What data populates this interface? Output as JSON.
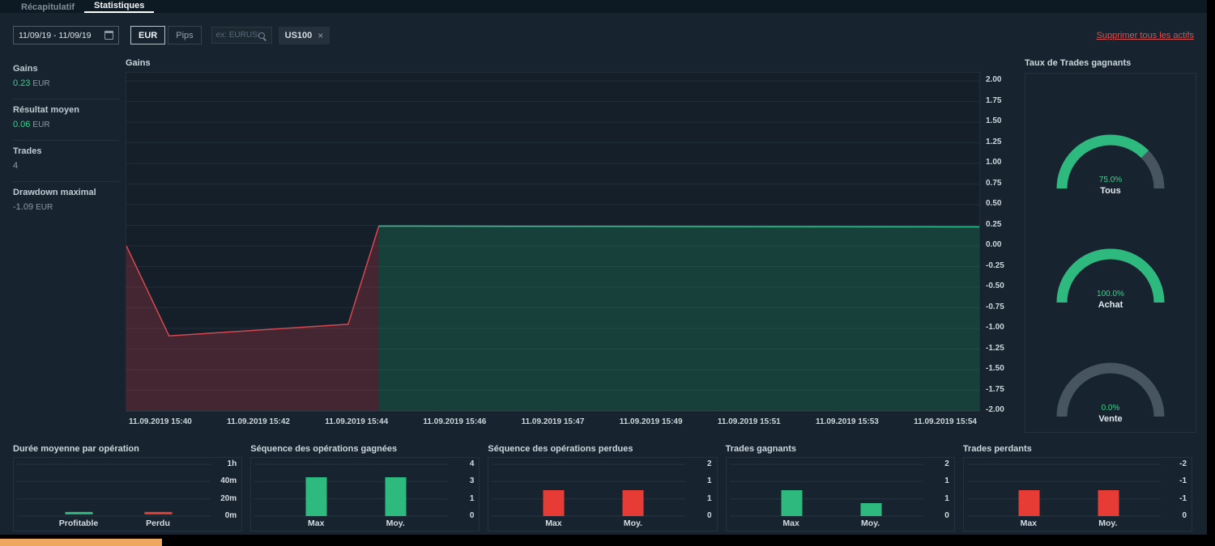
{
  "tabs": [
    {
      "label": "Récapitulatif",
      "active": false
    },
    {
      "label": "Statistiques",
      "active": true
    }
  ],
  "toolbar": {
    "date_range": "11/09/19 - 11/09/19",
    "unit_buttons": [
      {
        "label": "EUR",
        "active": true
      },
      {
        "label": "Pips",
        "active": false
      }
    ],
    "search_placeholder": "ex: EURUSD",
    "asset_tag": {
      "label": "US100",
      "remove": "×"
    },
    "remove_all_link": "Supprimer tous les actifs"
  },
  "summary_stats": [
    {
      "label": "Gains",
      "value": "0.23",
      "unit": "EUR",
      "tone": "green"
    },
    {
      "label": "Résultat moyen",
      "value": "0.06",
      "unit": "EUR",
      "tone": "green"
    },
    {
      "label": "Trades",
      "value": "4",
      "unit": "",
      "tone": "gray"
    },
    {
      "label": "Drawdown maximal",
      "value": "-1.09",
      "unit": "EUR",
      "tone": "gray"
    }
  ],
  "colors": {
    "green": "#2eb97e",
    "green_line": "#35c491",
    "green_fill": "rgba(34,150,104,0.28)",
    "green_text": "#3ecf8e",
    "red": "#e63c35",
    "red_line": "#d5484f",
    "red_fill": "rgba(178,55,65,0.30)",
    "grid": "#202e3a",
    "grid2": "#263442",
    "gauge_track": "#46555f",
    "link_red": "#d95151",
    "orange_strip": "#eda75e"
  },
  "chart_data": [
    {
      "id": "gains",
      "type": "area",
      "title": "Gains",
      "ylabel": "",
      "ylim": [
        -2,
        2
      ],
      "y_ticks": [
        "2.00",
        "1.75",
        "1.50",
        "1.25",
        "1.00",
        "0.75",
        "0.50",
        "0.25",
        "0.00",
        "-0.25",
        "-0.50",
        "-0.75",
        "-1.00",
        "-1.25",
        "-1.50",
        "-1.75",
        "-2.00"
      ],
      "x_ticks": [
        "11.09.2019 15:40",
        "11.09.2019 15:42",
        "11.09.2019 15:44",
        "11.09.2019 15:46",
        "11.09.2019 15:47",
        "11.09.2019 15:49",
        "11.09.2019 15:51",
        "11.09.2019 15:53",
        "11.09.2019 15:54"
      ],
      "series": [
        {
          "name": "losing-segment",
          "color_key": "red",
          "points": [
            [
              0.0,
              0.0
            ],
            [
              0.05,
              -1.09
            ],
            [
              0.26,
              -0.95
            ],
            [
              0.296,
              0.24
            ]
          ]
        },
        {
          "name": "winning-segment",
          "color_key": "green",
          "points": [
            [
              0.296,
              0.24
            ],
            [
              1.0,
              0.23
            ]
          ]
        }
      ]
    },
    {
      "id": "win_rate",
      "type": "gauge",
      "title": "Taux de Trades gagnants",
      "gauges": [
        {
          "label": "Tous",
          "value_pct": 75.0,
          "display": "75.0%"
        },
        {
          "label": "Achat",
          "value_pct": 100.0,
          "display": "100.0%"
        },
        {
          "label": "Vente",
          "value_pct": 0.0,
          "display": "0.0%"
        }
      ]
    },
    {
      "id": "avg_duration",
      "type": "duration",
      "title": "Durée moyenne par opération",
      "y_ticks": [
        "1h",
        "40m",
        "20m",
        "0m"
      ],
      "ymax_minutes": 60,
      "categories": [
        "Profitable",
        "Perdu"
      ],
      "values_minutes": [
        2,
        2
      ],
      "bar_colors": [
        "green",
        "red"
      ]
    },
    {
      "id": "win_streak",
      "type": "bar",
      "title": "Séquence des opérations gagnées",
      "y_ticks": [
        "4",
        "3",
        "1",
        "0"
      ],
      "ymax": 4,
      "categories": [
        "Max",
        "Moy."
      ],
      "values": [
        3,
        3
      ],
      "color_key": "green"
    },
    {
      "id": "loss_streak",
      "type": "bar",
      "title": "Séquence des opérations perdues",
      "y_ticks": [
        "2",
        "1",
        "1",
        "0"
      ],
      "ymax": 2,
      "categories": [
        "Max",
        "Moy."
      ],
      "values": [
        1,
        1
      ],
      "color_key": "red"
    },
    {
      "id": "winning_trades",
      "type": "bar",
      "title": "Trades gagnants",
      "y_ticks": [
        "2",
        "1",
        "1",
        "0"
      ],
      "ymax": 2,
      "categories": [
        "Max",
        "Moy."
      ],
      "values": [
        1,
        0.5
      ],
      "color_key": "green"
    },
    {
      "id": "losing_trades",
      "type": "bar",
      "title": "Trades perdants",
      "y_ticks": [
        "-2",
        "-1",
        "-1",
        "0"
      ],
      "ymax": 2,
      "categories": [
        "Max",
        "Moy."
      ],
      "values": [
        -1,
        -1
      ],
      "color_key": "red"
    }
  ]
}
